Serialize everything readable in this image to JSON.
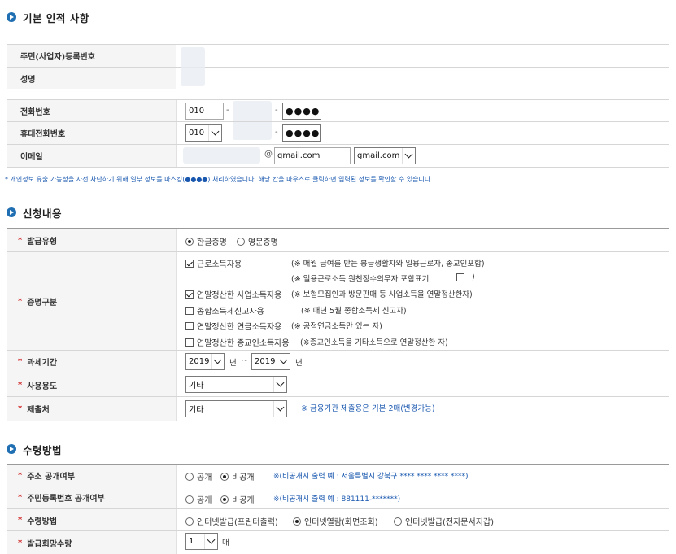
{
  "sections": {
    "basic": "기본 인적 사항",
    "apply": "신청내용",
    "receive": "수령방법"
  },
  "basic": {
    "rrn_label": "주민(사업자)등록번호",
    "name_label": "성명",
    "phone_label": "전화번호",
    "phone_first": "010",
    "phone_last": "●●●●",
    "mobile_label": "휴대전화번호",
    "mobile_first": "010",
    "mobile_last": "●●●●",
    "email_label": "이메일",
    "email_at": "@",
    "email_domain": "gmail.com",
    "email_domain_select": "gmail.com",
    "dash": "-"
  },
  "privacy_note": "* 개인정보 유출 가능성을 사전 차단하기 위해 일부 정보를 마스킹(●●●●) 처리하였습니다. 해당 칸을 마우스로 클릭하면 입력된 정보를 확인할 수 있습니다.",
  "apply": {
    "issue_type_label": "발급유형",
    "issue_type_options": [
      "한글증명",
      "영문증명"
    ],
    "cert_type_label": "증명구분",
    "cert_options": [
      {
        "label": "근로소득자용",
        "note": "(※ 매월 급여를 받는 봉급생활자와 일용근로자, 종교인포함)",
        "checked": true
      },
      {
        "label": "",
        "note": "(※ 일용근로소득 원천징수의무자 포함표기",
        "checked": false
      },
      {
        "label": "연말정산한 사업소득자용",
        "note": "(※ 보험모집인과 방문판매 등 사업소득을 연말정산한자)",
        "checked": true
      },
      {
        "label": "종합소득세신고자용",
        "note": "(※ 매년 5월 종합소득세 신고자)",
        "checked": false
      },
      {
        "label": "연말정산한 연금소득자용",
        "note": "(※ 공적연금소득만 있는 자)",
        "checked": false
      },
      {
        "label": "연말정산한 종교인소득자용",
        "note": "(※종교인소득을 기타소득으로 연말정산한 자)",
        "checked": false
      }
    ],
    "close_paren": ")",
    "period_label": "과세기간",
    "period_from": "2019",
    "period_to": "2019",
    "year_unit": "년",
    "tilde": "~",
    "purpose_label": "사용용도",
    "purpose_value": "기타",
    "submit_label": "제출처",
    "submit_value": "기타",
    "submit_note": "※ 금융기관 제출용은 기본 2매(변경가능)"
  },
  "receive": {
    "address_label": "주소 공개여부",
    "address_options": [
      "공개",
      "비공개"
    ],
    "address_note": "※(비공개시 출력 예 : 서울특별시 강북구 **** **** **** ****)",
    "rrn_label": "주민등록번호 공개여부",
    "rrn_options": [
      "공개",
      "비공개"
    ],
    "rrn_note": "※(비공개시 출력 예 : 881111-*******)",
    "method_label": "수령방법",
    "method_options": [
      "인터넷발급(프린터출력)",
      "인터넷열람(화면조회)",
      "인터넷발급(전자문서지갑)"
    ],
    "count_label": "발급희망수량",
    "count_value": "1",
    "count_unit": "매"
  },
  "colors": {
    "accent": "#1f6fb2",
    "required": "#d02020",
    "note_blue": "#1a58b0"
  }
}
